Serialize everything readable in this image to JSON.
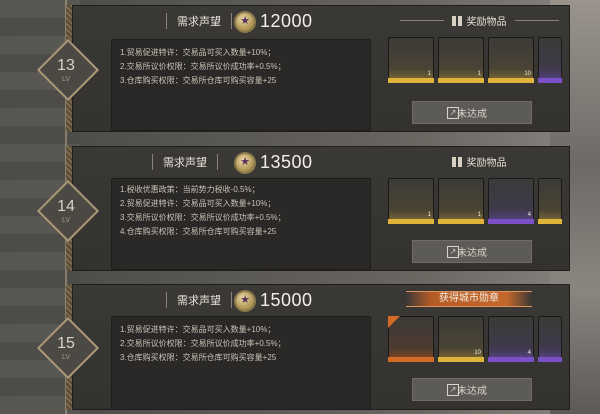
{
  "rows": [
    {
      "level": "13",
      "lv": "LV",
      "requirement_label": "需求声望",
      "requirement_value": "12000",
      "effects": [
        "1.贸易促进特许：交易品可买入数量+10%；",
        "2.交易所议价权限：交易所议价成功率+0.5%；",
        "3.仓库购买权限：交易所仓库可购买容量+25"
      ],
      "reward_title": "奖励物品",
      "items": [
        {
          "icon": "tablet-item-icon",
          "rarity": "gold",
          "count": "1"
        },
        {
          "icon": "engine-block-item-icon",
          "rarity": "gold",
          "count": "1"
        },
        {
          "icon": "capsule-item-icon",
          "rarity": "gold",
          "count": "10"
        },
        {
          "icon": "partial-item-icon",
          "rarity": "purple",
          "count": ""
        }
      ],
      "button": "未达成"
    },
    {
      "level": "14",
      "lv": "LV",
      "requirement_label": "需求声望",
      "requirement_value": "13500",
      "effects": [
        "1.税收优惠政策：当前势力税收-0.5%；",
        "2.贸易促进特许：交易品可买入数量+10%；",
        "3.交易所议价权限：交易所议价成功率+0.5%；",
        "4.仓库购买权限：交易所仓库可购买容量+25"
      ],
      "reward_title": "奖励物品",
      "items": [
        {
          "icon": "engine-block-item-icon",
          "rarity": "gold",
          "count": "1"
        },
        {
          "icon": "rifle-part-item-icon",
          "rarity": "gold",
          "count": "1"
        },
        {
          "icon": "document-item-icon",
          "rarity": "purple",
          "count": "4"
        },
        {
          "icon": "partial-item-icon",
          "rarity": "gold",
          "count": ""
        }
      ],
      "button": "未达成"
    },
    {
      "level": "15",
      "lv": "LV",
      "requirement_label": "需求声望",
      "requirement_value": "15000",
      "effects": [
        "1.贸易促进特许：交易品可买入数量+10%；",
        "2.交易所议价权限：交易所议价成功率+0.5%；",
        "3.仓库购买权限：交易所仓库可购买容量+25"
      ],
      "reward_title": "获得城市勋章",
      "items": [
        {
          "icon": "revolver-item-icon",
          "rarity": "orange",
          "count": ""
        },
        {
          "icon": "capsule-item-icon",
          "rarity": "gold",
          "count": "10"
        },
        {
          "icon": "document-item-icon",
          "rarity": "purple",
          "count": "4"
        },
        {
          "icon": "partial-item-icon",
          "rarity": "purple",
          "count": ""
        }
      ],
      "button": "未达成"
    }
  ]
}
